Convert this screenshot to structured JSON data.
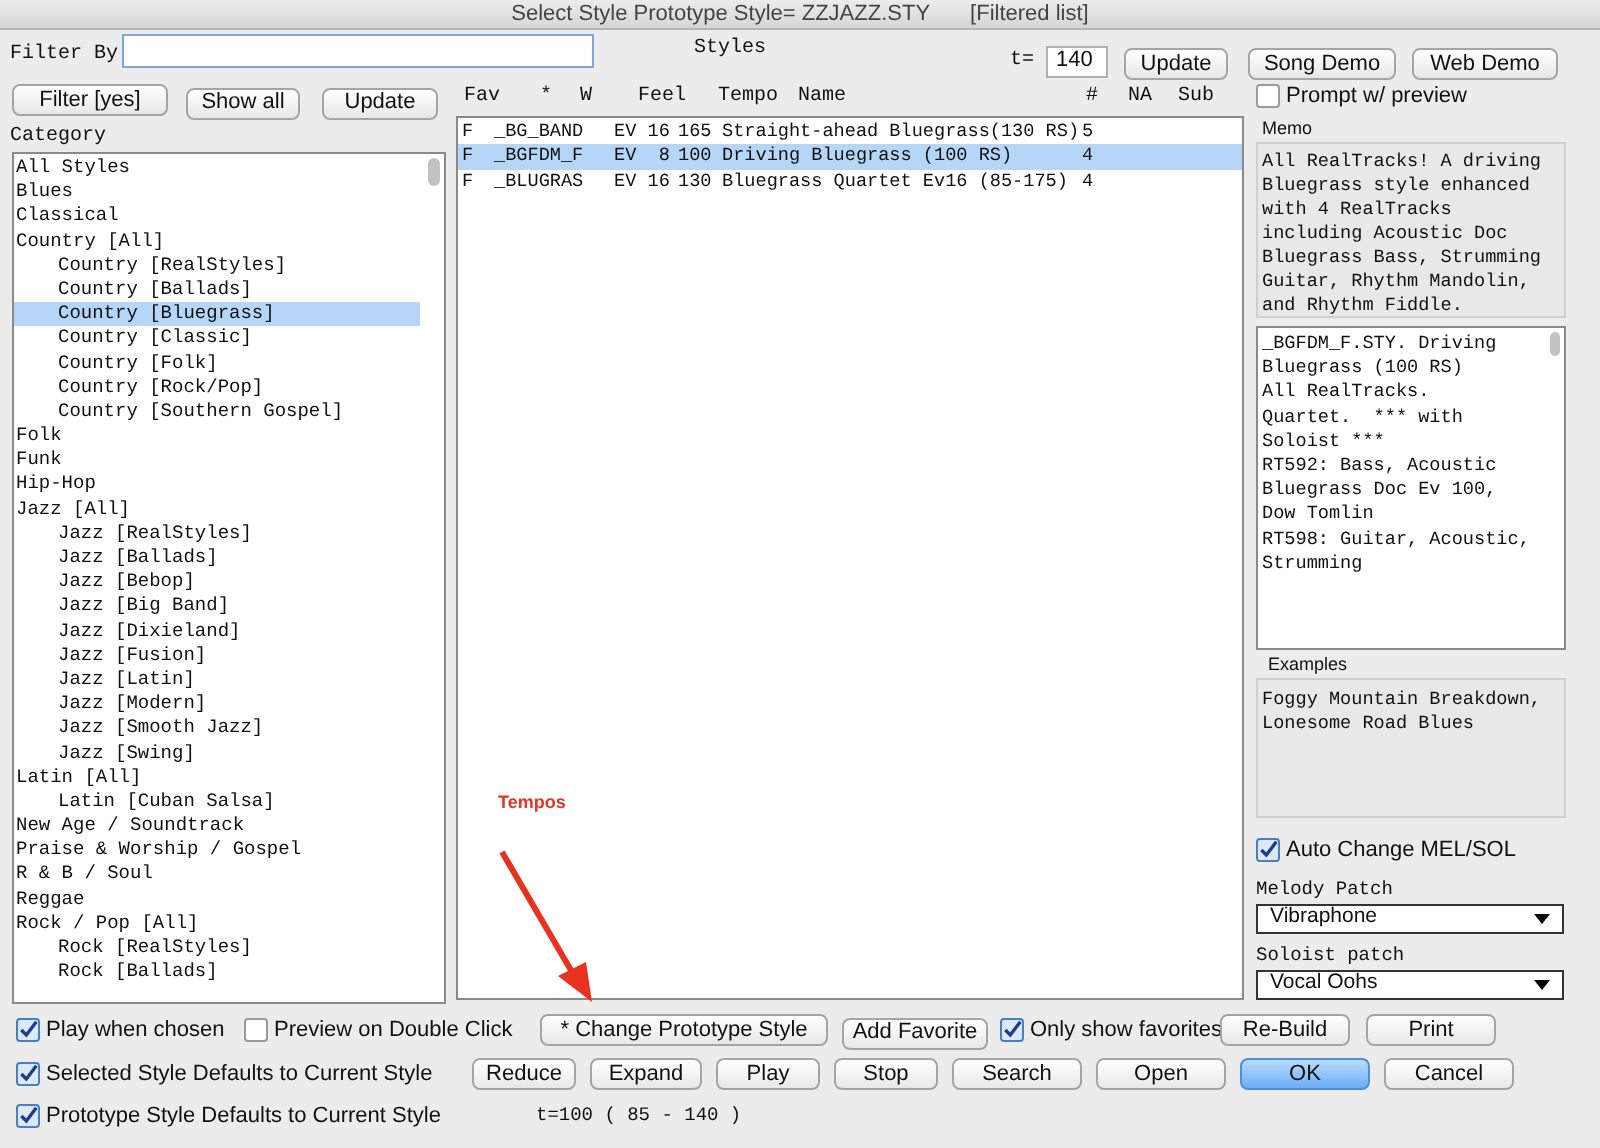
{
  "window": {
    "title": "Select Style Prototype Style= ZZJAZZ.STY",
    "subtitle": "[Filtered list]"
  },
  "filter": {
    "label": "Filter By"
  },
  "styles_label": "Styles",
  "tempo": {
    "label": "t=",
    "value": "140"
  },
  "top_buttons": [
    "Update",
    "Song Demo",
    "Web Demo"
  ],
  "left_buttons": [
    "Filter [yes]",
    "Show all",
    "Update"
  ],
  "category": {
    "label": "Category",
    "items": [
      {
        "label": "All Styles",
        "selected": false
      },
      {
        "label": "Blues",
        "selected": false
      },
      {
        "label": "Classical",
        "selected": false
      },
      {
        "label": "Country [All]",
        "selected": false,
        "children": [
          {
            "label": "Country [RealStyles]",
            "selected": false
          },
          {
            "label": "Country [Ballads]",
            "selected": false
          },
          {
            "label": "Country [Bluegrass]",
            "selected": true
          },
          {
            "label": "Country [Classic]",
            "selected": false
          },
          {
            "label": "Country [Folk]",
            "selected": false
          },
          {
            "label": "Country [Rock/Pop]",
            "selected": false
          },
          {
            "label": "Country [Southern Gospel]",
            "selected": false
          }
        ]
      },
      {
        "label": "Folk",
        "selected": false
      },
      {
        "label": "Funk",
        "selected": false
      },
      {
        "label": "Hip-Hop",
        "selected": false
      },
      {
        "label": "Jazz [All]",
        "selected": false,
        "children": [
          {
            "label": "Jazz [RealStyles]",
            "selected": false
          },
          {
            "label": "Jazz [Ballads]",
            "selected": false
          },
          {
            "label": "Jazz [Bebop]",
            "selected": false
          },
          {
            "label": "Jazz [Big Band]",
            "selected": false
          },
          {
            "label": "Jazz [Dixieland]",
            "selected": false
          },
          {
            "label": "Jazz [Fusion]",
            "selected": false
          },
          {
            "label": "Jazz [Latin]",
            "selected": false
          },
          {
            "label": "Jazz [Modern]",
            "selected": false
          },
          {
            "label": "Jazz [Smooth Jazz]",
            "selected": false
          },
          {
            "label": "Jazz [Swing]",
            "selected": false
          }
        ]
      },
      {
        "label": "Latin [All]",
        "selected": false,
        "children": [
          {
            "label": "Latin [Cuban Salsa]",
            "selected": false
          }
        ]
      },
      {
        "label": "New Age / Soundtrack",
        "selected": false
      },
      {
        "label": "Praise & Worship / Gospel",
        "selected": false
      },
      {
        "label": "R & B / Soul",
        "selected": false
      },
      {
        "label": "Reggae",
        "selected": false
      },
      {
        "label": "Rock / Pop [All]",
        "selected": false,
        "children": [
          {
            "label": "Rock [RealStyles]",
            "selected": false
          },
          {
            "label": "Rock [Ballads]",
            "selected": false
          }
        ]
      }
    ]
  },
  "table": {
    "columns": [
      "Fav",
      "*",
      "W",
      "Feel",
      "Tempo",
      "Name",
      "#",
      "NA",
      "Sub"
    ],
    "rows": [
      {
        "fav": "F",
        "file": "_BG_BAND",
        "feel": "EV 16",
        "tempo": "165",
        "name": "Straight-ahead Bluegrass(130 RS)",
        "count": "5",
        "selected": false
      },
      {
        "fav": "F",
        "file": "_BGFDM_F",
        "feel": "EV  8",
        "tempo": "100",
        "name": "Driving Bluegrass (100 RS)",
        "count": "4",
        "selected": true
      },
      {
        "fav": "F",
        "file": "_BLUGRAS",
        "feel": "EV 16",
        "tempo": "130",
        "name": "Bluegrass Quartet Ev16 (85-175)",
        "count": "4",
        "selected": false
      }
    ]
  },
  "annotation": {
    "label": "Tempos"
  },
  "prompt_preview": {
    "label": "Prompt w/ preview",
    "checked": false
  },
  "memo": {
    "label": "Memo",
    "text": "All RealTracks! A driving Bluegrass style enhanced with 4 RealTracks including Acoustic Doc Bluegrass Bass, Strumming Guitar, Rhythm Mandolin, and Rhythm Fiddle."
  },
  "details": [
    "_BGFDM_F.STY. Driving Bluegrass (100 RS)",
    "All RealTracks.",
    "Quartet.  *** with Soloist ***",
    "RT592: Bass, Acoustic Bluegrass Doc Ev 100, Dow Tomlin",
    "RT598: Guitar, Acoustic, Strumming"
  ],
  "examples": {
    "label": "Examples",
    "text": "Foggy Mountain Breakdown, Lonesome Road Blues"
  },
  "auto_change": {
    "label": "Auto Change MEL/SOL",
    "checked": true
  },
  "melody_patch": {
    "label": "Melody Patch",
    "value": "Vibraphone"
  },
  "soloist_patch": {
    "label": "Soloist patch",
    "value": "Vocal Oohs"
  },
  "options": [
    {
      "label": "Play when chosen",
      "checked": true
    },
    {
      "label": "Preview on Double Click",
      "checked": false
    },
    {
      "label": "Selected Style Defaults to Current Style",
      "checked": true
    },
    {
      "label": "Prototype Style Defaults to Current Style",
      "checked": true
    }
  ],
  "favorites_option": {
    "label": "Only show favorites",
    "checked": true
  },
  "button_row_1": [
    {
      "label": "* Change Prototype Style",
      "default": false
    },
    {
      "label": "Add Favorite",
      "default": false
    }
  ],
  "button_row_1_right": [
    {
      "label": "Re-Build",
      "default": false
    },
    {
      "label": "Print",
      "default": false
    }
  ],
  "button_row_2": [
    {
      "label": "Reduce",
      "default": false
    },
    {
      "label": "Expand",
      "default": false
    },
    {
      "label": "Play",
      "default": false
    },
    {
      "label": "Stop",
      "default": false
    },
    {
      "label": "Search",
      "default": false
    },
    {
      "label": "Open",
      "default": false
    },
    {
      "label": "OK",
      "default": true
    },
    {
      "label": "Cancel",
      "default": false
    }
  ],
  "tempo_range": "t=100 ( 85 - 140 )"
}
